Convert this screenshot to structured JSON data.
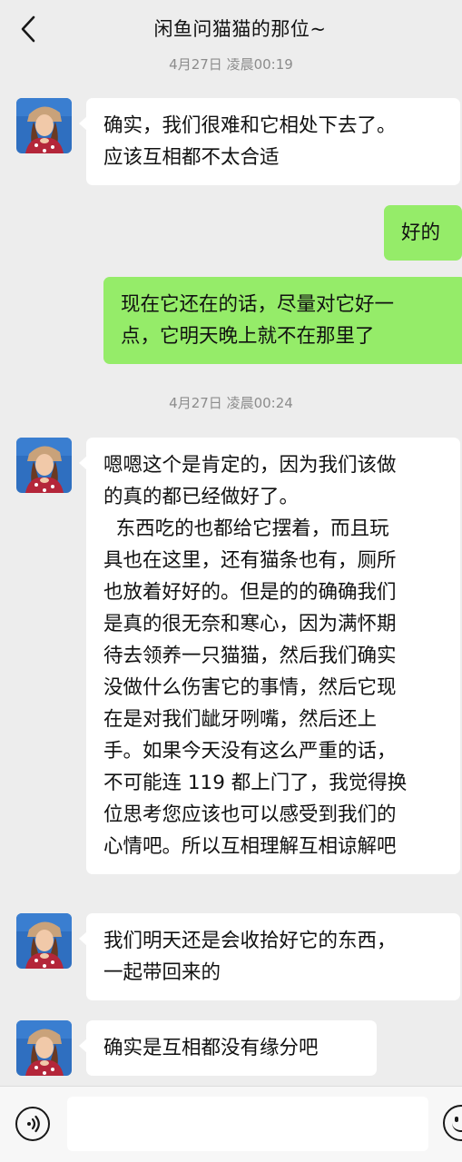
{
  "header": {
    "title": "闲鱼问猫猫的那位~",
    "back_icon": "chevron-left-icon"
  },
  "timestamps": [
    "4月27日 凌晨00:19",
    "4月27日 凌晨00:24"
  ],
  "messages": [
    {
      "side": "in",
      "lines": [
        "确实，我们很难和它相处下去了。",
        "应该互相都不太合适"
      ]
    },
    {
      "side": "out",
      "lines": [
        "好的"
      ]
    },
    {
      "side": "out",
      "lines": [
        "现在它还在的话，尽量对它好一",
        "点，它明天晚上就不在那里了"
      ]
    },
    {
      "side": "in",
      "lines": [
        "嗯嗯这个是肯定的，因为我们该做",
        "的真的都已经做好了。",
        "  东西吃的也都给它摆着，而且玩",
        "具也在这里，还有猫条也有，厕所",
        "也放着好好的。但是的的确确我们",
        "是真的很无奈和寒心，因为满怀期",
        "待去领养一只猫猫，然后我们确实",
        "没做什么伤害它的事情，然后它现",
        "在是对我们龇牙咧嘴，然后还上",
        "手。如果今天没有这么严重的话，",
        "不可能连 119 都上门了，我觉得换",
        "位思考您应该也可以感受到我们的",
        "心情吧。所以互相理解互相谅解吧"
      ]
    },
    {
      "side": "in",
      "lines": [
        "我们明天还是会收拾好它的东西，",
        "一起带回来的"
      ]
    },
    {
      "side": "in",
      "lines": [
        "确实是互相都没有缘分吧"
      ]
    }
  ],
  "input_bar": {
    "voice_icon": "voice-icon",
    "input_value": "",
    "emoji_icon": "emoji-icon"
  },
  "colors": {
    "background": "#ededed",
    "incoming_bubble": "#ffffff",
    "outgoing_bubble": "#95ec69"
  }
}
